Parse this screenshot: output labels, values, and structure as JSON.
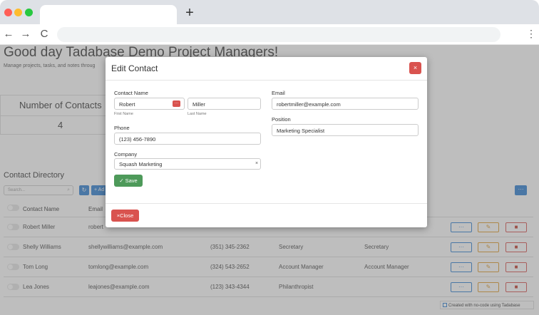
{
  "browser": {
    "new_tab": "+",
    "back": "←",
    "forward": "→",
    "reload": "C",
    "menu": "⋮"
  },
  "page": {
    "title": "Good day Tadabase Demo Project Managers!",
    "subtitle": "Manage projects, tasks, and notes throug",
    "stat": {
      "label": "Number of Contacts",
      "value": "4"
    },
    "directory_title": "Contact Directory",
    "search_placeholder": "Search...",
    "add_label": "+ Ad",
    "columns": [
      "Contact Name",
      "Email"
    ],
    "rows": [
      {
        "name": "Robert Miller",
        "email": "robert",
        "phone": "",
        "position": "",
        "position2": ""
      },
      {
        "name": "Shelly Williams",
        "email": "shellywilliams@example.com",
        "phone": "(351) 345-2362",
        "position": "Secretary",
        "position2": "Secretary"
      },
      {
        "name": "Tom Long",
        "email": "tomlong@example.com",
        "phone": "(324) 543-2652",
        "position": "Account Manager",
        "position2": "Account Manager"
      },
      {
        "name": "Lea Jones",
        "email": "leajones@example.com",
        "phone": "(123) 343-4344",
        "position": "Philanthropist",
        "position2": ""
      }
    ],
    "action_view": "···",
    "action_edit": "✎",
    "action_delete": "■",
    "credit": "Created with no-code using Tadabase"
  },
  "modal": {
    "title": "Edit Contact",
    "close_x": "×",
    "contact_name_label": "Contact Name",
    "first_name_value": "Robert",
    "first_name_sublabel": "First Name",
    "last_name_value": "Miller",
    "last_name_sublabel": "Last Name",
    "phone_label": "Phone",
    "phone_value": "(123) 456-7890",
    "company_label": "Company",
    "company_value": "Squash Marketing",
    "email_label": "Email",
    "email_value": "robertmiller@example.com",
    "position_label": "Position",
    "position_value": "Marketing Specialist",
    "save_label": "✓ Save",
    "close_label": "×Close"
  },
  "colors": {
    "primary": "#2d7fd1",
    "danger": "#d9534f",
    "success": "#4e9a5a",
    "warning": "#e09b2d"
  }
}
